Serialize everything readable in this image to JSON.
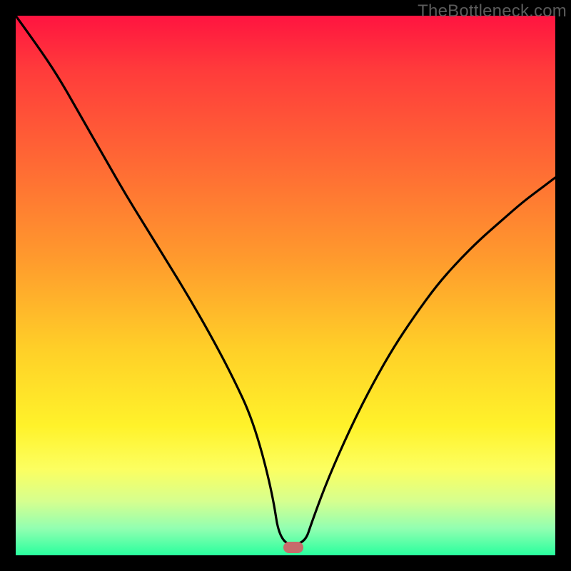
{
  "watermark": "TheBottleneck.com",
  "marker": {
    "color": "#c76b6b",
    "x_frac": 0.514,
    "y_frac": 0.986
  },
  "chart_data": {
    "type": "line",
    "title": "",
    "xlabel": "",
    "ylabel": "",
    "xlim": [
      0,
      1
    ],
    "ylim": [
      0,
      1
    ],
    "series": [
      {
        "name": "bottleneck-curve",
        "x": [
          0.0,
          0.04,
          0.08,
          0.12,
          0.16,
          0.2,
          0.24,
          0.28,
          0.32,
          0.36,
          0.4,
          0.44,
          0.475,
          0.49,
          0.535,
          0.55,
          0.58,
          0.62,
          0.66,
          0.7,
          0.74,
          0.78,
          0.82,
          0.86,
          0.9,
          0.94,
          0.98,
          1.0
        ],
        "values": [
          1.0,
          0.945,
          0.885,
          0.815,
          0.745,
          0.675,
          0.61,
          0.545,
          0.48,
          0.41,
          0.335,
          0.25,
          0.12,
          0.02,
          0.02,
          0.065,
          0.145,
          0.235,
          0.315,
          0.385,
          0.445,
          0.5,
          0.545,
          0.585,
          0.62,
          0.655,
          0.685,
          0.7
        ]
      }
    ],
    "background_gradient": {
      "top": "#ff1440",
      "mid": "#fff22a",
      "bottom": "#29ff9e"
    },
    "marker_point": {
      "x": 0.514,
      "y": 0.014
    }
  }
}
